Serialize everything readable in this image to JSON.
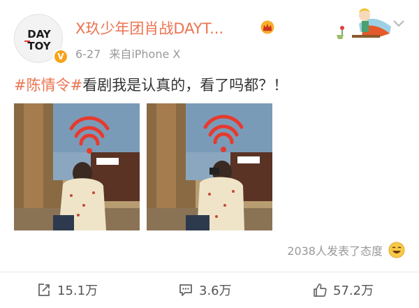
{
  "author": {
    "name": "X玖少年团肖战DAYT...",
    "avatar_logo_lines": [
      "DAY",
      "TOY"
    ],
    "verified_badge": "V",
    "accent_color": "#eb7350"
  },
  "meta": {
    "date": "6-27",
    "source": "来自iPhone X"
  },
  "post": {
    "hashtag": "#陈情令#",
    "text": "看剧我是认真的，看了吗都？！"
  },
  "photos": [
    {
      "label": "photo-left"
    },
    {
      "label": "photo-right"
    }
  ],
  "reactions": {
    "text": "2038人发表了态度",
    "icon": "laughing-emoji-icon"
  },
  "actions": {
    "repost_count": "15.1万",
    "comment_count": "3.6万",
    "like_count": "57.2万"
  },
  "icons": {
    "crown": "crown-icon",
    "chevron": "chevron-down-icon",
    "repost": "repost-icon",
    "comment": "comment-icon",
    "like": "thumbs-up-icon"
  }
}
